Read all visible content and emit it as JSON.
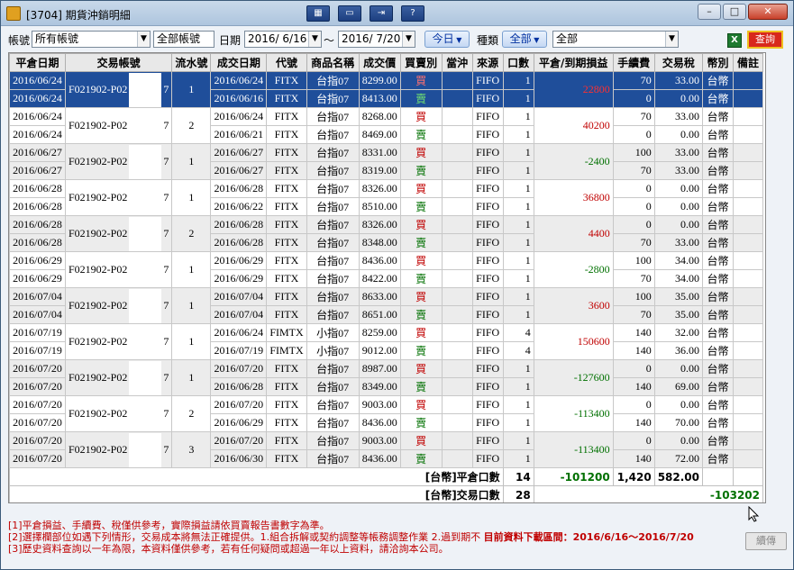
{
  "window": {
    "title": "[3704] 期貨沖銷明細",
    "min": "–",
    "max": "□",
    "close": "✕"
  },
  "toolbar_icons": [
    "columns-icon",
    "window-icon",
    "export-icon",
    "help-icon"
  ],
  "filter": {
    "account_label": "帳號",
    "account_value": "所有帳號",
    "account_name": "全部帳號",
    "date_label": "日期",
    "date_from": "2016/ 6/16",
    "tilde": "～",
    "date_to": "2016/ 7/20",
    "today_btn": "今日",
    "type_label": "種類",
    "type_value": "全部",
    "product_value": "全部",
    "excel": "X",
    "query_btn": "查詢"
  },
  "headers": [
    "平倉日期",
    "交易帳號",
    "流水號",
    "成交日期",
    "代號",
    "商品名稱",
    "成交價",
    "買賣別",
    "當沖",
    "來源",
    "口數",
    "平倉/到期損益",
    "手續費",
    "交易稅",
    "幣別",
    "備註"
  ],
  "rows": [
    {
      "close_date": "2016/06/24",
      "account": "F021902-P02",
      "acct_suffix": "7",
      "serial": "1",
      "pl": "22800",
      "pl_sign": "pos",
      "sel": true,
      "gray": false,
      "legs": [
        {
          "trade_date": "2016/06/24",
          "code": "FITX",
          "name": "台指07",
          "price": "8299.00",
          "side": "買",
          "side_cls": "buy",
          "source": "FIFO",
          "qty": "1",
          "fee": "70",
          "tax": "33.00",
          "cur": "台幣"
        },
        {
          "trade_date": "2016/06/16",
          "code": "FITX",
          "name": "台指07",
          "price": "8413.00",
          "side": "賣",
          "side_cls": "sell",
          "source": "FIFO",
          "qty": "1",
          "fee": "0",
          "tax": "0.00",
          "cur": "台幣"
        }
      ]
    },
    {
      "close_date": "2016/06/24",
      "account": "F021902-P02",
      "acct_suffix": "7",
      "serial": "2",
      "pl": "40200",
      "pl_sign": "pos",
      "sel": false,
      "gray": false,
      "legs": [
        {
          "trade_date": "2016/06/24",
          "code": "FITX",
          "name": "台指07",
          "price": "8268.00",
          "side": "買",
          "side_cls": "buy",
          "source": "FIFO",
          "qty": "1",
          "fee": "70",
          "tax": "33.00",
          "cur": "台幣"
        },
        {
          "trade_date": "2016/06/21",
          "code": "FITX",
          "name": "台指07",
          "price": "8469.00",
          "side": "賣",
          "side_cls": "sell",
          "source": "FIFO",
          "qty": "1",
          "fee": "0",
          "tax": "0.00",
          "cur": "台幣"
        }
      ]
    },
    {
      "close_date": "2016/06/27",
      "account": "F021902-P02",
      "acct_suffix": "7",
      "serial": "1",
      "pl": "-2400",
      "pl_sign": "neg",
      "sel": false,
      "gray": true,
      "legs": [
        {
          "trade_date": "2016/06/27",
          "code": "FITX",
          "name": "台指07",
          "price": "8331.00",
          "side": "買",
          "side_cls": "buy",
          "source": "FIFO",
          "qty": "1",
          "fee": "100",
          "tax": "33.00",
          "cur": "台幣"
        },
        {
          "trade_date": "2016/06/27",
          "code": "FITX",
          "name": "台指07",
          "price": "8319.00",
          "side": "賣",
          "side_cls": "sell",
          "source": "FIFO",
          "qty": "1",
          "fee": "70",
          "tax": "33.00",
          "cur": "台幣"
        }
      ]
    },
    {
      "close_date": "2016/06/28",
      "account": "F021902-P02",
      "acct_suffix": "7",
      "serial": "1",
      "pl": "36800",
      "pl_sign": "pos",
      "sel": false,
      "gray": false,
      "legs": [
        {
          "trade_date": "2016/06/28",
          "code": "FITX",
          "name": "台指07",
          "price": "8326.00",
          "side": "買",
          "side_cls": "buy",
          "source": "FIFO",
          "qty": "1",
          "fee": "0",
          "tax": "0.00",
          "cur": "台幣"
        },
        {
          "trade_date": "2016/06/22",
          "code": "FITX",
          "name": "台指07",
          "price": "8510.00",
          "side": "賣",
          "side_cls": "sell",
          "source": "FIFO",
          "qty": "1",
          "fee": "0",
          "tax": "0.00",
          "cur": "台幣"
        }
      ]
    },
    {
      "close_date": "2016/06/28",
      "account": "F021902-P02",
      "acct_suffix": "7",
      "serial": "2",
      "pl": "4400",
      "pl_sign": "pos",
      "sel": false,
      "gray": true,
      "legs": [
        {
          "trade_date": "2016/06/28",
          "code": "FITX",
          "name": "台指07",
          "price": "8326.00",
          "side": "買",
          "side_cls": "buy",
          "source": "FIFO",
          "qty": "1",
          "fee": "0",
          "tax": "0.00",
          "cur": "台幣"
        },
        {
          "trade_date": "2016/06/28",
          "code": "FITX",
          "name": "台指07",
          "price": "8348.00",
          "side": "賣",
          "side_cls": "sell",
          "source": "FIFO",
          "qty": "1",
          "fee": "70",
          "tax": "33.00",
          "cur": "台幣"
        }
      ]
    },
    {
      "close_date": "2016/06/29",
      "account": "F021902-P02",
      "acct_suffix": "7",
      "serial": "1",
      "pl": "-2800",
      "pl_sign": "neg",
      "sel": false,
      "gray": false,
      "legs": [
        {
          "trade_date": "2016/06/29",
          "code": "FITX",
          "name": "台指07",
          "price": "8436.00",
          "side": "買",
          "side_cls": "buy",
          "source": "FIFO",
          "qty": "1",
          "fee": "100",
          "tax": "34.00",
          "cur": "台幣"
        },
        {
          "trade_date": "2016/06/29",
          "code": "FITX",
          "name": "台指07",
          "price": "8422.00",
          "side": "賣",
          "side_cls": "sell",
          "source": "FIFO",
          "qty": "1",
          "fee": "70",
          "tax": "34.00",
          "cur": "台幣"
        }
      ]
    },
    {
      "close_date": "2016/07/04",
      "account": "F021902-P02",
      "acct_suffix": "7",
      "serial": "1",
      "pl": "3600",
      "pl_sign": "pos",
      "sel": false,
      "gray": true,
      "legs": [
        {
          "trade_date": "2016/07/04",
          "code": "FITX",
          "name": "台指07",
          "price": "8633.00",
          "side": "買",
          "side_cls": "buy",
          "source": "FIFO",
          "qty": "1",
          "fee": "100",
          "tax": "35.00",
          "cur": "台幣"
        },
        {
          "trade_date": "2016/07/04",
          "code": "FITX",
          "name": "台指07",
          "price": "8651.00",
          "side": "賣",
          "side_cls": "sell",
          "source": "FIFO",
          "qty": "1",
          "fee": "70",
          "tax": "35.00",
          "cur": "台幣"
        }
      ]
    },
    {
      "close_date": "2016/07/19",
      "account": "F021902-P02",
      "acct_suffix": "7",
      "serial": "1",
      "pl": "150600",
      "pl_sign": "pos",
      "sel": false,
      "gray": false,
      "legs": [
        {
          "trade_date": "2016/06/24",
          "code": "FIMTX",
          "name": "小指07",
          "price": "8259.00",
          "side": "買",
          "side_cls": "buy",
          "source": "FIFO",
          "qty": "4",
          "fee": "140",
          "tax": "32.00",
          "cur": "台幣"
        },
        {
          "trade_date": "2016/07/19",
          "code": "FIMTX",
          "name": "小指07",
          "price": "9012.00",
          "side": "賣",
          "side_cls": "sell",
          "source": "FIFO",
          "qty": "4",
          "fee": "140",
          "tax": "36.00",
          "cur": "台幣"
        }
      ]
    },
    {
      "close_date": "2016/07/20",
      "account": "F021902-P02",
      "acct_suffix": "7",
      "serial": "1",
      "pl": "-127600",
      "pl_sign": "neg",
      "sel": false,
      "gray": true,
      "legs": [
        {
          "trade_date": "2016/07/20",
          "code": "FITX",
          "name": "台指07",
          "price": "8987.00",
          "side": "買",
          "side_cls": "buy",
          "source": "FIFO",
          "qty": "1",
          "fee": "0",
          "tax": "0.00",
          "cur": "台幣"
        },
        {
          "trade_date": "2016/06/28",
          "code": "FITX",
          "name": "台指07",
          "price": "8349.00",
          "side": "賣",
          "side_cls": "sell",
          "source": "FIFO",
          "qty": "1",
          "fee": "140",
          "tax": "69.00",
          "cur": "台幣"
        }
      ]
    },
    {
      "close_date": "2016/07/20",
      "account": "F021902-P02",
      "acct_suffix": "7",
      "serial": "2",
      "pl": "-113400",
      "pl_sign": "neg",
      "sel": false,
      "gray": false,
      "legs": [
        {
          "trade_date": "2016/07/20",
          "code": "FITX",
          "name": "台指07",
          "price": "9003.00",
          "side": "買",
          "side_cls": "buy",
          "source": "FIFO",
          "qty": "1",
          "fee": "0",
          "tax": "0.00",
          "cur": "台幣"
        },
        {
          "trade_date": "2016/06/29",
          "code": "FITX",
          "name": "台指07",
          "price": "8436.00",
          "side": "賣",
          "side_cls": "sell",
          "source": "FIFO",
          "qty": "1",
          "fee": "140",
          "tax": "70.00",
          "cur": "台幣"
        }
      ]
    },
    {
      "close_date": "2016/07/20",
      "account": "F021902-P02",
      "acct_suffix": "7",
      "serial": "3",
      "pl": "-113400",
      "pl_sign": "neg",
      "sel": false,
      "gray": true,
      "legs": [
        {
          "trade_date": "2016/07/20",
          "code": "FITX",
          "name": "台指07",
          "price": "9003.00",
          "side": "買",
          "side_cls": "buy",
          "source": "FIFO",
          "qty": "1",
          "fee": "0",
          "tax": "0.00",
          "cur": "台幣"
        },
        {
          "trade_date": "2016/06/30",
          "code": "FITX",
          "name": "台指07",
          "price": "8436.00",
          "side": "賣",
          "side_cls": "sell",
          "source": "FIFO",
          "qty": "1",
          "fee": "140",
          "tax": "72.00",
          "cur": "台幣"
        }
      ]
    }
  ],
  "summary": {
    "close_label": "[台幣]平倉口數",
    "close_qty": "14",
    "close_pl": "-101200",
    "close_fee": "1,420",
    "close_tax": "582.00",
    "trade_label": "[台幣]交易口數",
    "trade_qty": "28",
    "net": "-103202"
  },
  "notes": {
    "n1": "[1]平倉損益、手續費、稅僅供參考，實際損益請依買賣報告書數字為準。",
    "n2": "[2]選擇欄部位如遇下列情形，交易成本將無法正確提供。1.組合拆解或契約調整等帳務調整作業 2.過到期不",
    "range": "目前資料下載區間：2016/6/16～2016/7/20",
    "n3": "[3]歷史資料查詢以一年為限，本資料僅供參考，若有任何疑問或超過一年以上資料，請洽詢本公司。"
  },
  "continue_btn": "續傳"
}
